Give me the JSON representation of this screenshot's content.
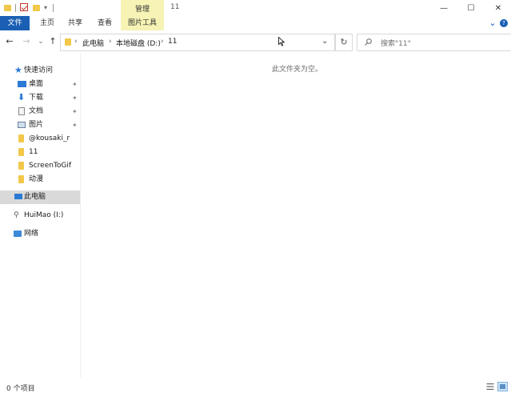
{
  "title": {
    "folder_name": "11",
    "minimize": "—",
    "maximize": "☐",
    "close": "✕"
  },
  "ribbon": {
    "tabs": [
      "文件",
      "主页",
      "共享",
      "查看"
    ],
    "context_group": "管理",
    "context_tab": "图片工具",
    "chevron": "⌄",
    "help": "?"
  },
  "nav": {
    "back": "←",
    "forward": "→",
    "recent": "⌄",
    "up": "↑",
    "breadcrumbs": [
      "此电脑",
      "本地磁盘 (D:)",
      "11"
    ],
    "dropdown": "⌄",
    "refresh": "↻",
    "search_placeholder": "搜索\"11\""
  },
  "sidebar": {
    "quick_access": "快速访问",
    "quick_items": [
      "桌面",
      "下载",
      "文档",
      "图片"
    ],
    "folders": [
      "@kousaki_r",
      "11",
      "ScreenToGif",
      "动漫"
    ],
    "this_pc": "此电脑",
    "drive": "HuiMao (I:)",
    "network": "网络",
    "pin": "📌"
  },
  "content": {
    "empty_text": "此文件夹为空。"
  },
  "status": {
    "count": "0 个项目"
  }
}
